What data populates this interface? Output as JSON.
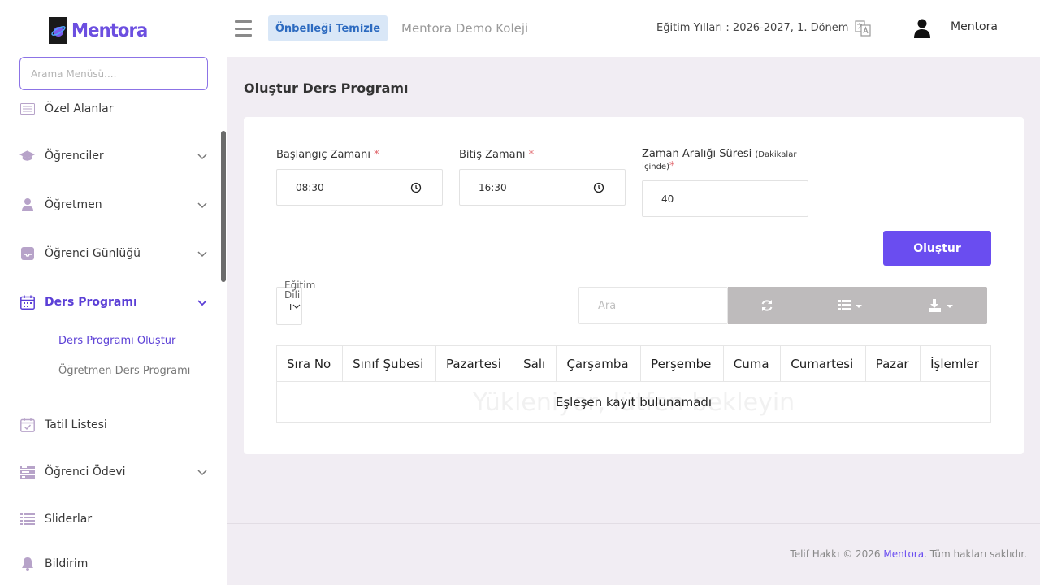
{
  "brand": {
    "logo_text": "Mentora"
  },
  "sidebar": {
    "search_placeholder": "Arama Menüsü....",
    "items": [
      {
        "label": "Özel Alanlar",
        "icon": "list-icon",
        "expandable": false
      },
      {
        "label": "Öğrenciler",
        "icon": "graduation-cap-icon",
        "expandable": true
      },
      {
        "label": "Öğretmen",
        "icon": "user-icon",
        "expandable": true
      },
      {
        "label": "Öğrenci Günlüğü",
        "icon": "inbox-icon",
        "expandable": true
      },
      {
        "label": "Ders Programı",
        "icon": "calendar-icon",
        "expandable": true,
        "active": true
      },
      {
        "label": "Tatil Listesi",
        "icon": "calendar-check-icon",
        "expandable": false
      },
      {
        "label": "Öğrenci Ödevi",
        "icon": "tasks-icon",
        "expandable": true
      },
      {
        "label": "Sliderlar",
        "icon": "list-lines-icon",
        "expandable": false
      },
      {
        "label": "Bildirim",
        "icon": "bell-icon",
        "expandable": false
      }
    ],
    "subitems": [
      {
        "label": "Ders Programı Oluştur",
        "active": true
      },
      {
        "label": "Öğretmen Ders Programı",
        "active": false
      }
    ]
  },
  "header": {
    "cache_button": "Önbelleği Temizle",
    "school_name": "Mentora Demo Koleji",
    "edu_year": "Eğitim Yılları : 2026-2027, 1. Dönem",
    "user_name": "Mentora"
  },
  "main": {
    "page_title": "Oluştur Ders Programı",
    "form": {
      "start_label": "Başlangıç Zamanı",
      "start_value": "08:30",
      "end_label": "Bitiş Zamanı",
      "end_value": "16:30",
      "interval_label": "Zaman Aralığı Süresi",
      "interval_hint_1": "(Dakikalar",
      "interval_hint_2": "İçinde)",
      "interval_value": "40",
      "required_mark": "*",
      "create_button": "Oluştur"
    },
    "table_toolbar": {
      "edu_lang_label_1": "Eğitim",
      "edu_lang_label_2": "Dili",
      "edu_lang_value": "I",
      "search_placeholder": "Ara"
    },
    "table": {
      "columns": [
        "Sıra No",
        "Sınıf Şubesi",
        "Pazartesi",
        "Salı",
        "Çarşamba",
        "Perşembe",
        "Cuma",
        "Cumartesi",
        "Pazar",
        "İşlemler"
      ],
      "loading_text": "Yükleniyor, lütfen bekleyin",
      "empty_text": "Eşleşen kayıt bulunamadı"
    }
  },
  "footer": {
    "prefix": "Telif Hakkı © 2026 ",
    "brand": "Mentora",
    "suffix": ". Tüm hakları saklıdır."
  },
  "colors": {
    "accent": "#6a4df0",
    "sidebar_active": "#5b3fd6",
    "page_bg": "#f1edf3",
    "cache_btn_bg": "#d9e7f7",
    "toolbar_bg": "#bebbbc"
  }
}
